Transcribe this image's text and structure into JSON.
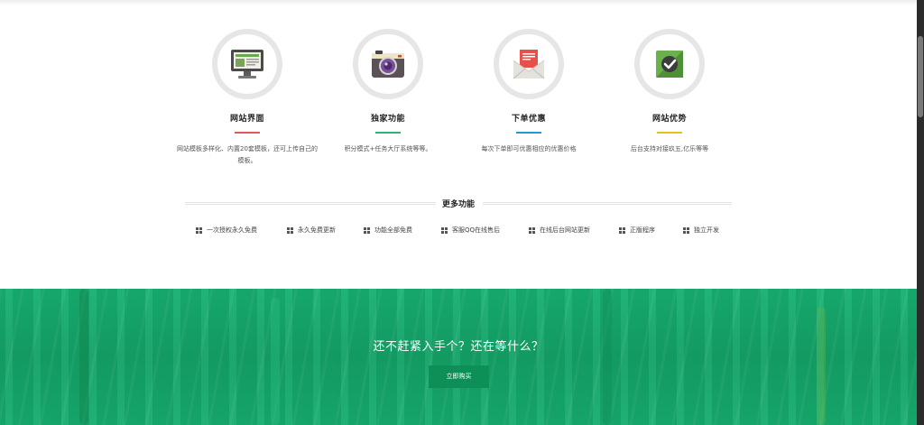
{
  "features": [
    {
      "title": "网站界面",
      "desc": "网站模板多样化、内置20套模板，还可上传自己的模板。",
      "icon": "monitor-icon",
      "accent": "#e05a5a"
    },
    {
      "title": "独家功能",
      "desc": "积分模式+任务大厅系统等等。",
      "icon": "camera-icon",
      "accent": "#2bb673"
    },
    {
      "title": "下单优惠",
      "desc": "每次下单即可优惠相应的优惠价格",
      "icon": "envelope-icon",
      "accent": "#1e9ad6"
    },
    {
      "title": "网站优势",
      "desc": "后台支持对接玖五,亿乐等等",
      "icon": "checkbox-icon",
      "accent": "#e3c21b"
    }
  ],
  "more": {
    "title": "更多功能",
    "items": [
      "一次授权永久免费",
      "永久免费更新",
      "功能全部免费",
      "客服QQ在线售后",
      "在线后台网站更新",
      "正版程序",
      "独立开发"
    ]
  },
  "cta": {
    "heading": "还不赶紧入手个？还在等什么？",
    "button": "立即购买",
    "color": "#17a86c"
  }
}
